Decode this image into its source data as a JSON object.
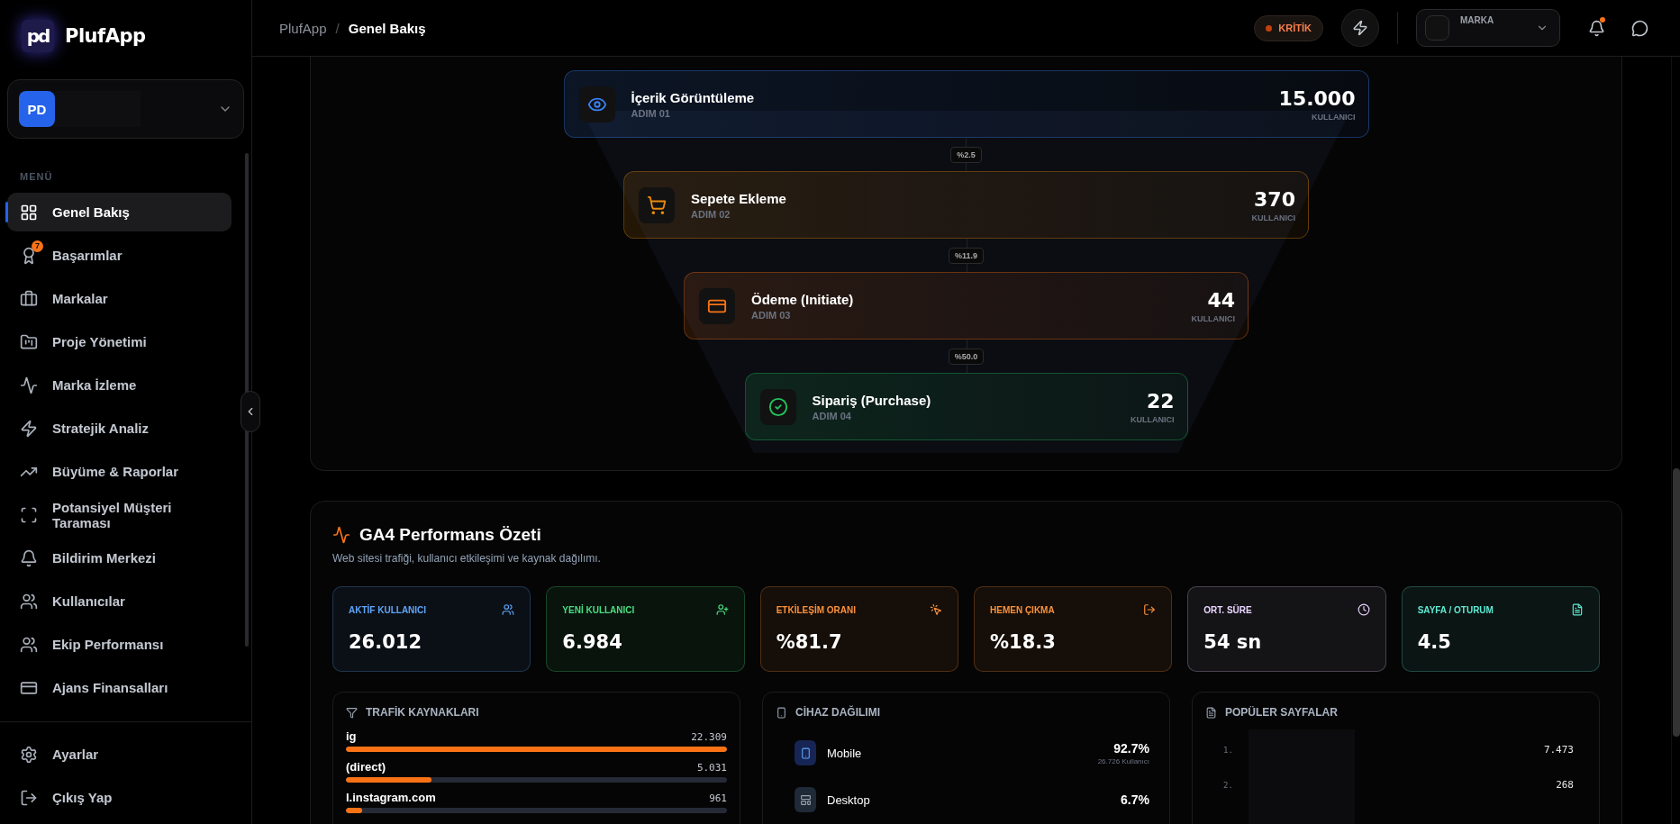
{
  "brand": {
    "logo": "pd",
    "name": "PlufApp"
  },
  "account": {
    "initials": "PD"
  },
  "sidebar": {
    "section_label": "MENÜ",
    "items": [
      {
        "label": "Genel Bakış",
        "kind": "grid",
        "selected": true
      },
      {
        "label": "Başarımlar",
        "kind": "award",
        "selected": false,
        "badge": "7"
      },
      {
        "label": "Markalar",
        "kind": "briefcase",
        "selected": false
      },
      {
        "label": "Proje Yönetimi",
        "kind": "folder",
        "selected": false
      },
      {
        "label": "Marka İzleme",
        "kind": "pulse",
        "selected": false
      },
      {
        "label": "Stratejik Analiz",
        "kind": "zap",
        "selected": false
      },
      {
        "label": "Büyüme & Raporlar",
        "kind": "trend",
        "selected": false
      },
      {
        "label": "Potansiyel Müşteri Taraması",
        "kind": "scan",
        "selected": false
      },
      {
        "label": "Bildirim Merkezi",
        "kind": "bell",
        "selected": false
      },
      {
        "label": "Kullanıcılar",
        "kind": "users",
        "selected": false
      },
      {
        "label": "Ekip Performansı",
        "kind": "users",
        "selected": false
      },
      {
        "label": "Ajans Finansalları",
        "kind": "card",
        "selected": false
      }
    ],
    "footer_items": [
      {
        "label": "Ayarlar",
        "kind": "settings"
      },
      {
        "label": "Çıkış Yap",
        "kind": "logout"
      }
    ]
  },
  "breadcrumb": {
    "items": [
      "PlufApp",
      "Genel Bakış"
    ],
    "separator": "/"
  },
  "topbar": {
    "status": {
      "label": "KRİTİK"
    },
    "brand_select": {
      "label": "MARKA"
    },
    "notifications": {
      "unread": true
    }
  },
  "funnel": {
    "steps": [
      {
        "title": "İçerik Görüntüleme",
        "step": "ADIM 01",
        "value": "15.000",
        "unit": "KULLANICI",
        "kind": "eye",
        "color": "#3b82f6"
      },
      {
        "title": "Sepete Ekleme",
        "step": "ADIM 02",
        "value": "370",
        "unit": "KULLANICI",
        "kind": "cart",
        "color": "#ea8a0c"
      },
      {
        "title": "Ödeme (Initiate)",
        "step": "ADIM 03",
        "value": "44",
        "unit": "KULLANICI",
        "kind": "card",
        "color": "#f97316"
      },
      {
        "title": "Sipariş (Purchase)",
        "step": "ADIM 04",
        "value": "22",
        "unit": "KULLANICI",
        "kind": "check",
        "color": "#22c55e"
      }
    ],
    "rates": [
      "%2.5",
      "%11.9",
      "%50.0"
    ]
  },
  "ga4": {
    "title": "GA4 Performans Özeti",
    "subtitle": "Web sitesi trafiği, kullanıcı etkileşimi ve kaynak dağılımı.",
    "metrics": [
      {
        "label": "AKTİF KULLANICI",
        "value": "26.012",
        "kind": "users",
        "color": "#60a5fa"
      },
      {
        "label": "YENİ KULLANICI",
        "value": "6.984",
        "kind": "user-plus",
        "color": "#4ade80"
      },
      {
        "label": "ETKİLEŞİM ORANI",
        "value": "%81.7",
        "kind": "pointer",
        "color": "#fb923c"
      },
      {
        "label": "HEMEN ÇIKMA",
        "value": "%18.3",
        "kind": "exit",
        "color": "#fb923c"
      },
      {
        "label": "ORT. SÜRE",
        "value": "54 sn",
        "kind": "clock",
        "color": "#e9d5ff"
      },
      {
        "label": "SAYFA / OTURUM",
        "value": "4.5",
        "kind": "file",
        "color": "#5eead4"
      }
    ],
    "traffic": {
      "title": "TRAFİK KAYNAKLARI",
      "sources": [
        {
          "name": "ig",
          "value": "22.309",
          "level": 1
        },
        {
          "name": "(direct)",
          "value": "5.031",
          "level": 0.225
        },
        {
          "name": "l.instagram.com",
          "value": "961",
          "level": 0.043
        }
      ]
    },
    "devices": {
      "title": "CİHAZ DAĞILIMI",
      "items": [
        {
          "name": "Mobile",
          "percent": "92.7%",
          "detail": "26.726 Kullanıcı",
          "kind": "phone"
        },
        {
          "name": "Desktop",
          "percent": "6.7%",
          "kind": "desktop"
        }
      ]
    },
    "pages": {
      "title": "POPÜLER SAYFALAR",
      "items": [
        {
          "rank": "1.",
          "value": "7.473"
        },
        {
          "rank": "2.",
          "value": "268"
        }
      ]
    }
  }
}
